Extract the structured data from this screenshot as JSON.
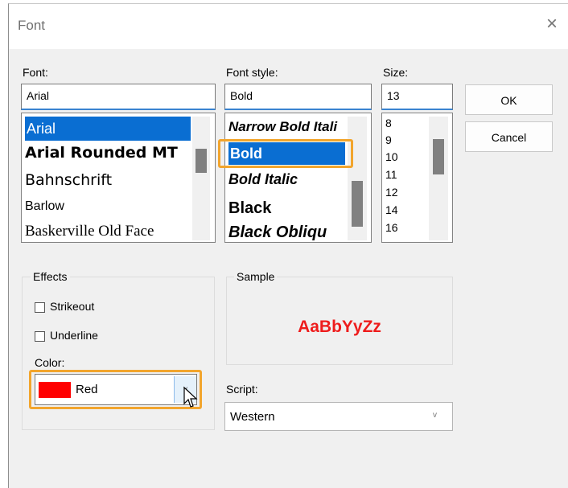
{
  "dialog": {
    "title": "Font",
    "close_glyph": "×"
  },
  "font": {
    "label": "Font:",
    "value": "Arial",
    "items": [
      "Arial",
      "Arial Rounded MT",
      "Bahnschrift",
      "Barlow",
      "Baskerville Old Face"
    ],
    "selected_index": 0
  },
  "style": {
    "label": "Font style:",
    "value": "Bold",
    "items": [
      "Narrow Bold Itali",
      "Bold",
      "Bold Italic",
      "Black",
      "Black Obliqu"
    ],
    "selected_index": 1
  },
  "size": {
    "label": "Size:",
    "value": "13",
    "items": [
      "8",
      "9",
      "10",
      "11",
      "12",
      "14",
      "16"
    ]
  },
  "buttons": {
    "ok": "OK",
    "cancel": "Cancel"
  },
  "effects": {
    "label": "Effects",
    "strikeout": {
      "label": "Strikeout",
      "checked": false
    },
    "underline": {
      "label": "Underline",
      "checked": false
    },
    "color_label": "Color:",
    "color_value": "Red",
    "color_swatch": "#ff0000"
  },
  "sample": {
    "label": "Sample",
    "text": "AaBbYyZz",
    "color": "#ee1c1c"
  },
  "script": {
    "label": "Script:",
    "value": "Western"
  },
  "colors": {
    "selection": "#0a6ed2",
    "highlight": "#f2a52d",
    "focus_underline": "#3a83d0"
  }
}
